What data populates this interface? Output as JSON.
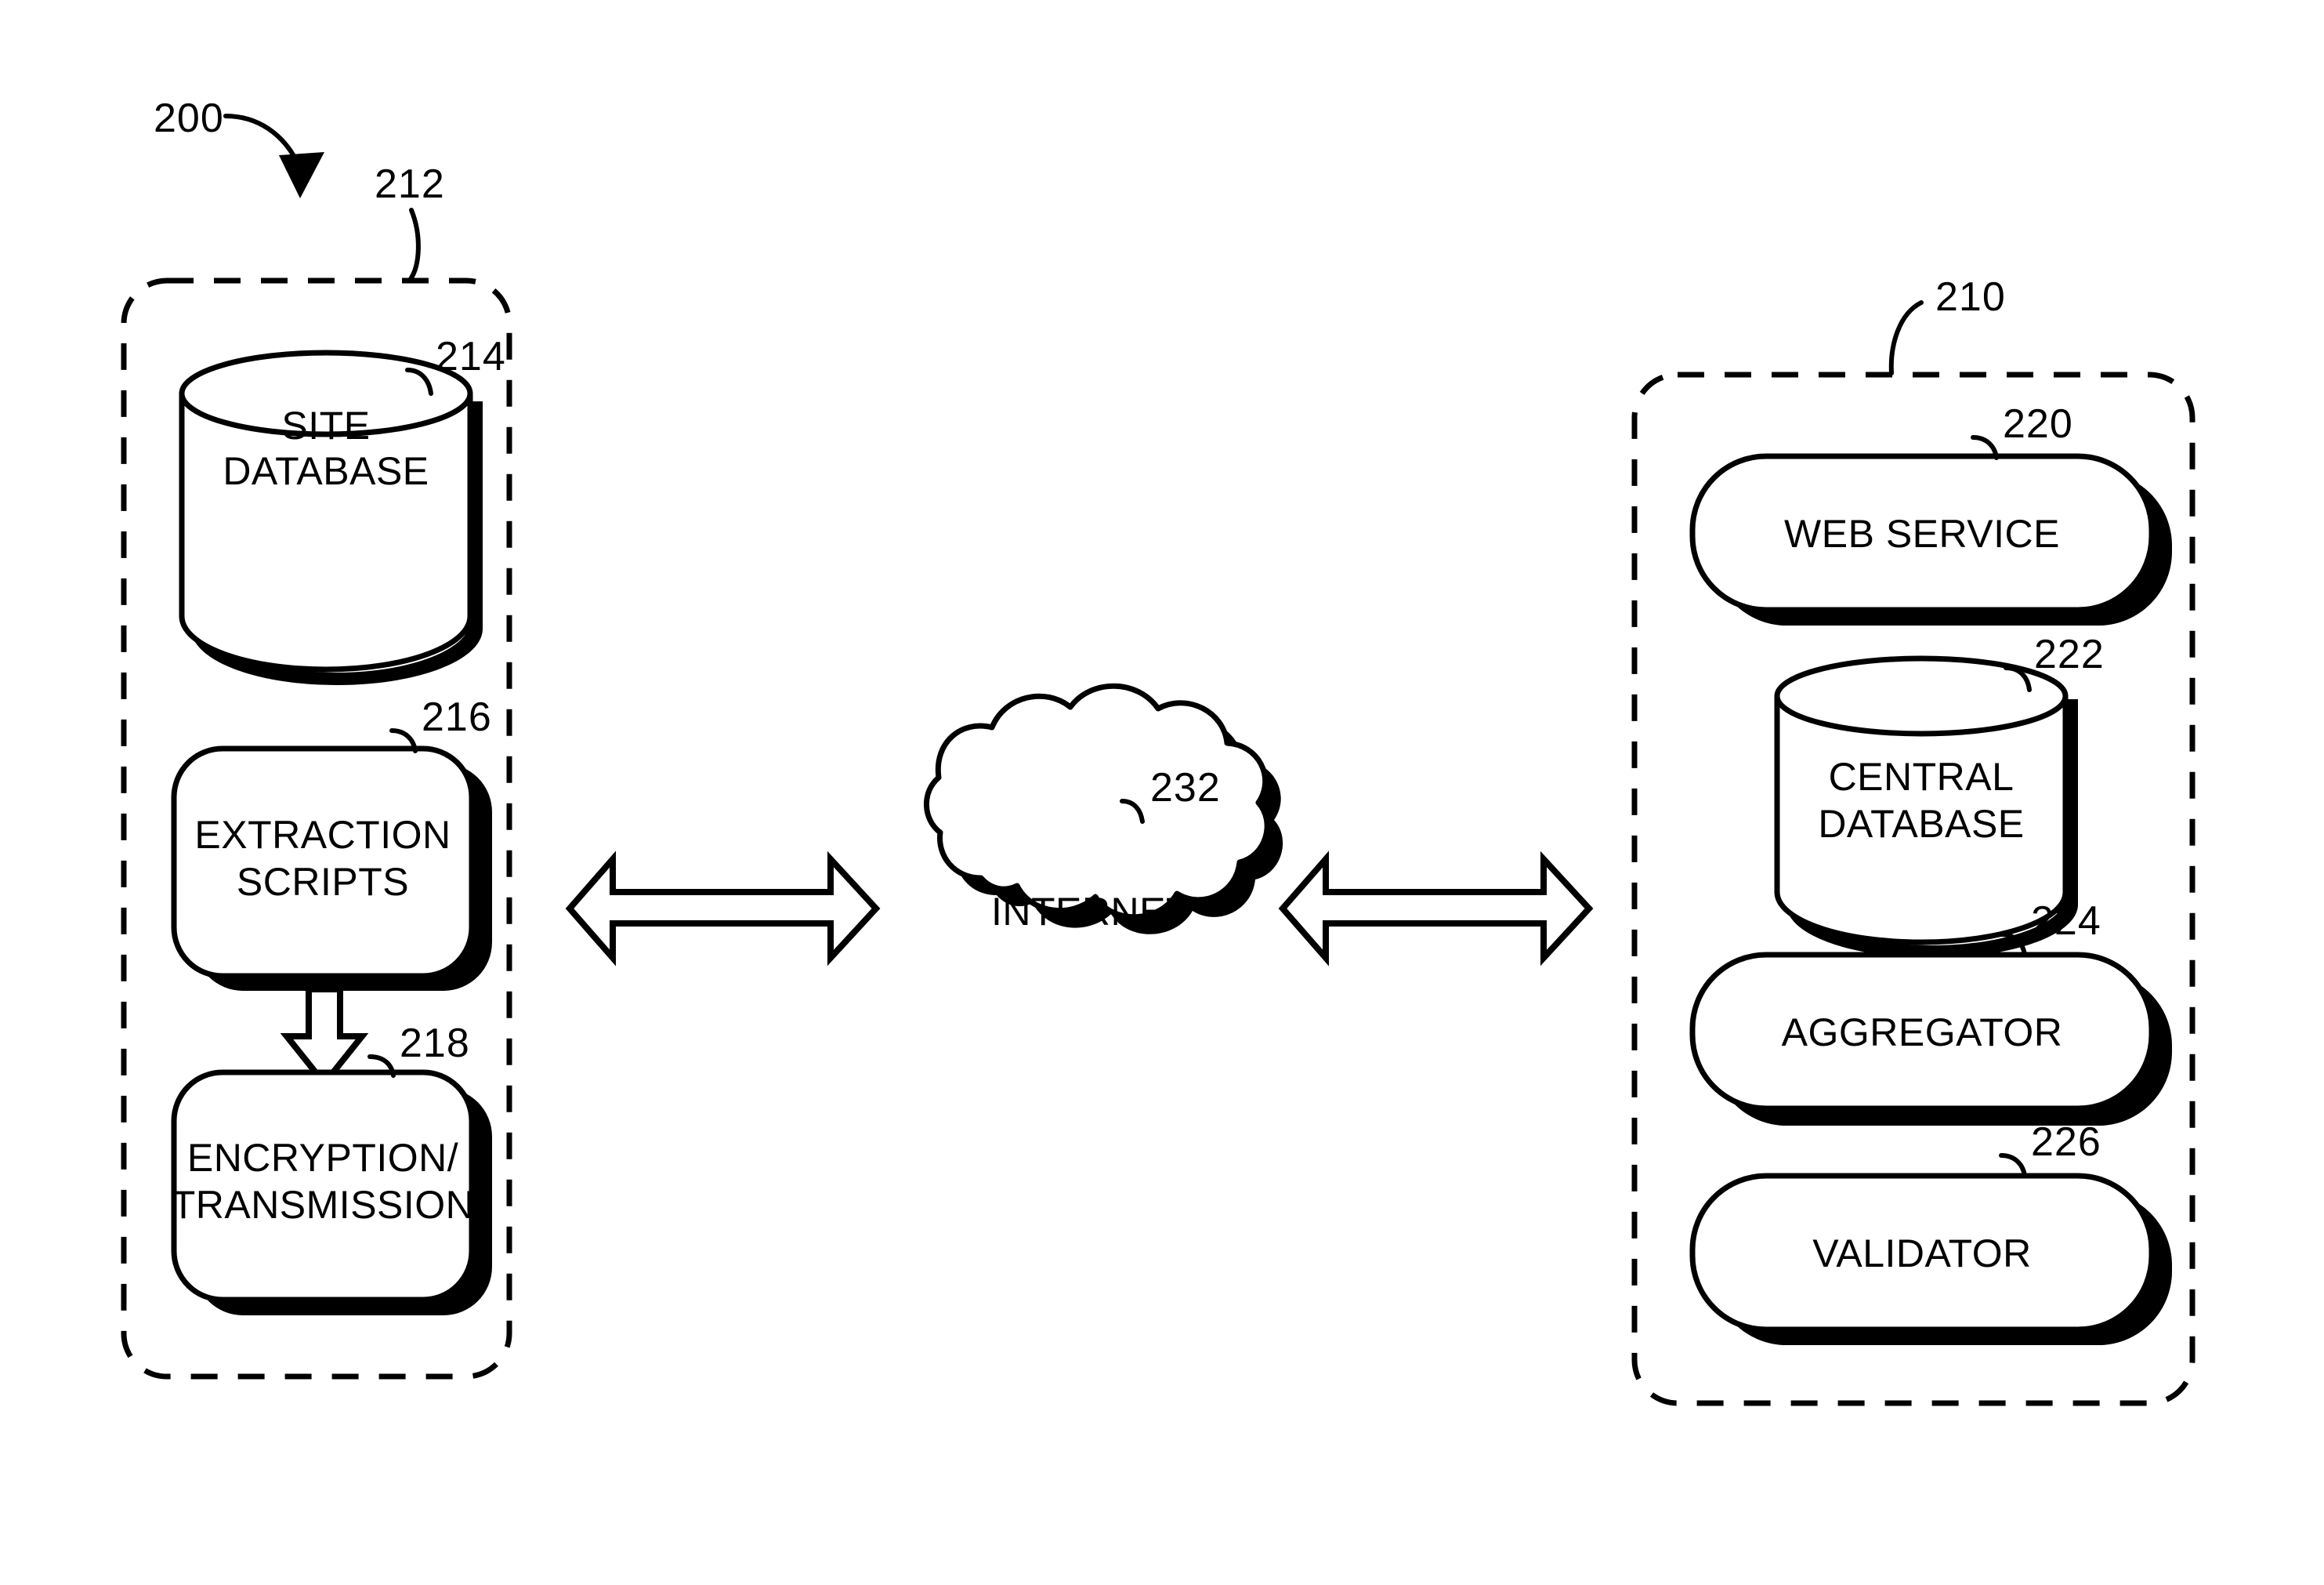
{
  "figure": {
    "figure_number": "200",
    "background_color": "#ffffff",
    "line_color": "#000000",
    "style": "patent-line-drawing"
  },
  "groups": {
    "left": {
      "ref": "212",
      "name": "site-system-container",
      "nodes": [
        {
          "ref": "214",
          "label_line1": "SITE",
          "label_line2": "DATABASE",
          "shape": "cylinder"
        },
        {
          "ref": "216",
          "label_line1": "EXTRACTION",
          "label_line2": "SCRIPTS",
          "shape": "rounded-rect"
        },
        {
          "ref": "218",
          "label_line1": "ENCRYPTION/",
          "label_line2": "TRANSMISSION",
          "shape": "rounded-rect"
        }
      ]
    },
    "right": {
      "ref": "210",
      "name": "central-system-container",
      "nodes": [
        {
          "ref": "220",
          "label_line1": "WEB SERVICE",
          "label_line2": "",
          "shape": "pill"
        },
        {
          "ref": "222",
          "label_line1": "CENTRAL",
          "label_line2": "DATABASE",
          "shape": "cylinder"
        },
        {
          "ref": "224",
          "label_line1": "AGGREGATOR",
          "label_line2": "",
          "shape": "pill"
        },
        {
          "ref": "226",
          "label_line1": "VALIDATOR",
          "label_line2": "",
          "shape": "pill"
        }
      ]
    }
  },
  "network": {
    "ref": "232",
    "label": "INTERNET",
    "shape": "cloud"
  },
  "connectors": {
    "left_link": "double-headed-arrow",
    "right_link": "double-headed-arrow",
    "internal_flow": "down-arrow"
  }
}
